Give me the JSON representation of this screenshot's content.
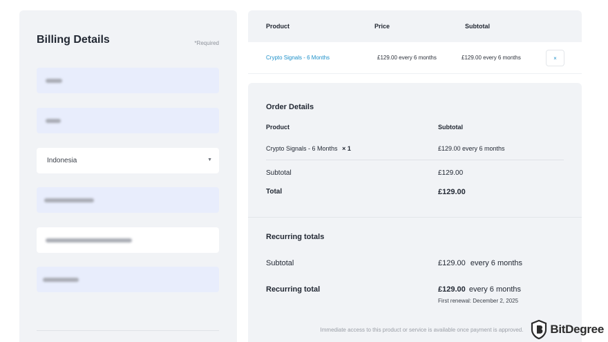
{
  "billing": {
    "title": "Billing Details",
    "required_note": "*Required",
    "country": "Indonesia"
  },
  "cart": {
    "headers": {
      "product": "Product",
      "price": "Price",
      "subtotal": "Subtotal"
    },
    "row": {
      "product": "Crypto Signals - 6 Months",
      "price": "£129.00 every 6 months",
      "subtotal": "£129.00 every 6 months",
      "remove": "×"
    }
  },
  "order": {
    "title": "Order Details",
    "col_product": "Product",
    "col_subtotal": "Subtotal",
    "item_name": "Crypto Signals - 6 Months",
    "item_qty": "× 1",
    "item_subtotal": "£129.00 every 6 months",
    "subtotal_label": "Subtotal",
    "subtotal_value": "£129.00",
    "total_label": "Total",
    "total_value": "£129.00"
  },
  "recurring": {
    "title": "Recurring totals",
    "subtotal_label": "Subtotal",
    "subtotal_value": "£129.00",
    "subtotal_period": "every 6 months",
    "total_label": "Recurring total",
    "total_value": "£129.00",
    "total_period": "every 6 months",
    "renewal": "First renewal: December 2, 2025"
  },
  "note": "Immediate access to this product or service is available once payment is approved.",
  "watermark": {
    "brand": "BitDegree",
    "icon": "shield-logo-icon"
  },
  "colors": {
    "accent": "#1b8fc9",
    "field_fill": "#e8edfc",
    "panel": "#f1f3f6"
  }
}
